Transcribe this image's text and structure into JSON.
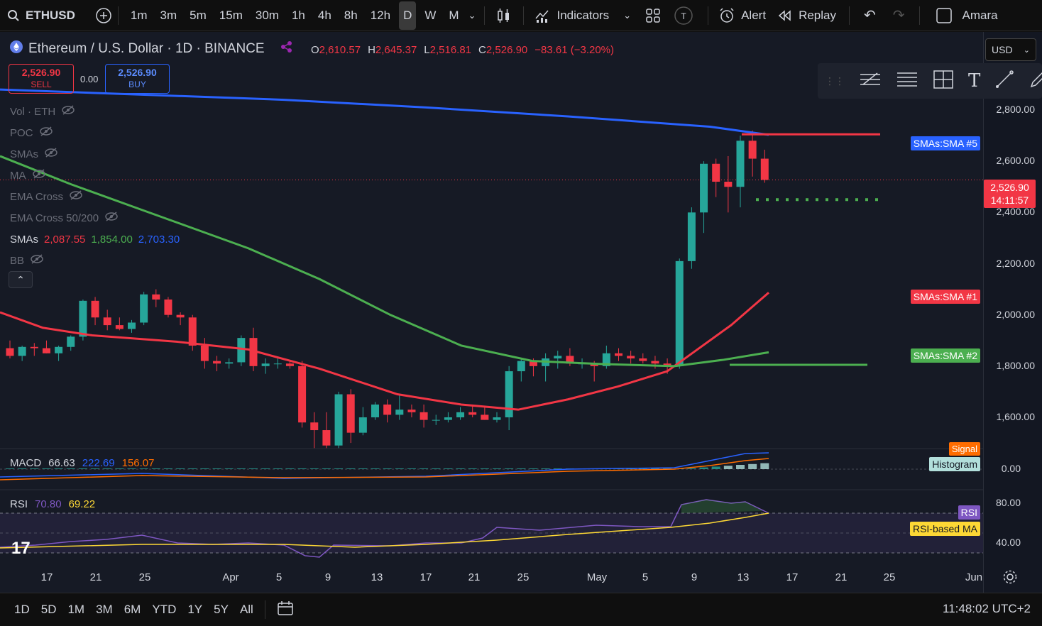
{
  "toolbar": {
    "symbol": "ETHUSD",
    "intervals": [
      "1m",
      "3m",
      "5m",
      "15m",
      "30m",
      "1h",
      "4h",
      "8h",
      "12h",
      "D",
      "W",
      "M"
    ],
    "active_interval": "D",
    "indicators_label": "Indicators",
    "alert_label": "Alert",
    "replay_label": "Replay",
    "user_label": "Amara"
  },
  "header": {
    "title": "Ethereum / U.S. Dollar · 1D · BINANCE",
    "ohlc": {
      "o_key": "O",
      "o": "2,610.57",
      "h_key": "H",
      "h": "2,645.37",
      "l_key": "L",
      "l": "2,516.81",
      "c_key": "C",
      "c": "2,526.90",
      "change": "−83.61 (−3.20%)"
    },
    "currency": "USD"
  },
  "trade": {
    "sell_price": "2,526.90",
    "sell_label": "SELL",
    "spread": "0.00",
    "buy_price": "2,526.90",
    "buy_label": "BUY"
  },
  "indicators": [
    {
      "label": "Vol · ETH",
      "visible": false
    },
    {
      "label": "POC",
      "visible": false
    },
    {
      "label": "SMAs",
      "visible": false
    },
    {
      "label": "MA",
      "visible": false
    },
    {
      "label": "EMA Cross",
      "visible": false
    },
    {
      "label": "EMA Cross 50/200",
      "visible": false
    }
  ],
  "smas": {
    "label": "SMAs",
    "v1": "2,087.55",
    "v2": "1,854.00",
    "v3": "2,703.30",
    "c1": "#f23645",
    "c2": "#4caf50",
    "c3": "#2962ff"
  },
  "bb_label": "BB",
  "price_axis": {
    "labels": [
      "2,800.00",
      "2,600.00",
      "2,400.00",
      "2,200.00",
      "2,000.00",
      "1,800.00",
      "1,600.00"
    ],
    "current_price": "2,526.90",
    "countdown": "14:11:57"
  },
  "sma_tags": {
    "sma5": "SMAs:SMA #5",
    "sma1": "SMAs:SMA #1",
    "sma2": "SMAs:SMA #2"
  },
  "macd": {
    "label": "MACD",
    "v1": "66.63",
    "v2": "222.69",
    "v3": "156.07",
    "tag_signal": "Signal",
    "tag_hist": "Histogram",
    "zero": "0.00"
  },
  "rsi": {
    "label": "RSI",
    "v1": "70.80",
    "v2": "69.22",
    "tag_rsi": "RSI",
    "tag_ma": "RSI-based MA",
    "l80": "80.00",
    "l40": "40.00"
  },
  "time_axis": [
    "17",
    "21",
    "25",
    "Apr",
    "5",
    "9",
    "13",
    "17",
    "21",
    "25",
    "May",
    "5",
    "9",
    "13",
    "17",
    "21",
    "25",
    "Jun"
  ],
  "bottom": {
    "ranges": [
      "1D",
      "5D",
      "1M",
      "3M",
      "6M",
      "YTD",
      "1Y",
      "5Y",
      "All"
    ],
    "clock": "11:48:02 UTC+2"
  },
  "colors": {
    "up": "#26a69a",
    "down": "#f23645",
    "sma_blue": "#2962ff",
    "sma_red": "#f23645",
    "sma_green": "#4caf50"
  },
  "chart_data": {
    "type": "candlestick",
    "title": "Ethereum / U.S. Dollar · 1D · BINANCE",
    "ylim": [
      1470,
      2900
    ],
    "candles": [
      [
        1870,
        1900,
        1830,
        1840
      ],
      [
        1840,
        1880,
        1820,
        1875
      ],
      [
        1875,
        1890,
        1840,
        1870
      ],
      [
        1870,
        1900,
        1850,
        1850
      ],
      [
        1850,
        1880,
        1820,
        1875
      ],
      [
        1875,
        1920,
        1860,
        1915
      ],
      [
        1915,
        2060,
        1900,
        2055
      ],
      [
        2055,
        2070,
        1960,
        1990
      ],
      [
        1990,
        2020,
        1940,
        1960
      ],
      [
        1960,
        1990,
        1940,
        1945
      ],
      [
        1945,
        1980,
        1930,
        1970
      ],
      [
        1970,
        2090,
        1960,
        2080
      ],
      [
        2080,
        2100,
        2030,
        2060
      ],
      [
        2060,
        2070,
        1990,
        2000
      ],
      [
        2000,
        2010,
        1960,
        1990
      ],
      [
        1990,
        2000,
        1860,
        1880
      ],
      [
        1880,
        1910,
        1790,
        1820
      ],
      [
        1820,
        1840,
        1780,
        1810
      ],
      [
        1810,
        1830,
        1790,
        1815
      ],
      [
        1815,
        1920,
        1800,
        1910
      ],
      [
        1910,
        1950,
        1780,
        1800
      ],
      [
        1800,
        1830,
        1770,
        1810
      ],
      [
        1810,
        1830,
        1790,
        1810
      ],
      [
        1810,
        1820,
        1790,
        1800
      ],
      [
        1800,
        1820,
        1560,
        1580
      ],
      [
        1580,
        1620,
        1480,
        1550
      ],
      [
        1550,
        1620,
        1480,
        1490
      ],
      [
        1490,
        1700,
        1480,
        1690
      ],
      [
        1690,
        1710,
        1500,
        1540
      ],
      [
        1540,
        1640,
        1530,
        1600
      ],
      [
        1600,
        1660,
        1590,
        1650
      ],
      [
        1650,
        1670,
        1580,
        1610
      ],
      [
        1610,
        1690,
        1590,
        1630
      ],
      [
        1630,
        1650,
        1600,
        1620
      ],
      [
        1620,
        1650,
        1560,
        1590
      ],
      [
        1590,
        1610,
        1570,
        1590
      ],
      [
        1590,
        1620,
        1580,
        1600
      ],
      [
        1600,
        1640,
        1590,
        1620
      ],
      [
        1620,
        1650,
        1600,
        1610
      ],
      [
        1610,
        1640,
        1590,
        1590
      ],
      [
        1590,
        1620,
        1580,
        1600
      ],
      [
        1600,
        1800,
        1550,
        1780
      ],
      [
        1780,
        1830,
        1740,
        1820
      ],
      [
        1820,
        1830,
        1760,
        1800
      ],
      [
        1800,
        1850,
        1740,
        1830
      ],
      [
        1830,
        1860,
        1790,
        1840
      ],
      [
        1840,
        1870,
        1800,
        1810
      ],
      [
        1810,
        1830,
        1790,
        1810
      ],
      [
        1810,
        1820,
        1740,
        1800
      ],
      [
        1800,
        1880,
        1790,
        1850
      ],
      [
        1850,
        1870,
        1820,
        1840
      ],
      [
        1840,
        1860,
        1810,
        1830
      ],
      [
        1830,
        1850,
        1810,
        1820
      ],
      [
        1820,
        1840,
        1790,
        1810
      ],
      [
        1810,
        1830,
        1770,
        1800
      ],
      [
        1800,
        2220,
        1790,
        2210
      ],
      [
        2210,
        2420,
        2180,
        2400
      ],
      [
        2400,
        2600,
        2320,
        2590
      ],
      [
        2590,
        2610,
        2460,
        2520
      ],
      [
        2520,
        2620,
        2400,
        2500
      ],
      [
        2500,
        2700,
        2420,
        2680
      ],
      [
        2680,
        2720,
        2540,
        2610
      ],
      [
        2610,
        2645,
        2516,
        2527
      ]
    ],
    "series": [
      {
        "name": "SMAs:SMA #5",
        "color": "#2962ff"
      },
      {
        "name": "SMAs:SMA #1",
        "color": "#f23645"
      },
      {
        "name": "SMAs:SMA #2",
        "color": "#4caf50"
      }
    ]
  }
}
